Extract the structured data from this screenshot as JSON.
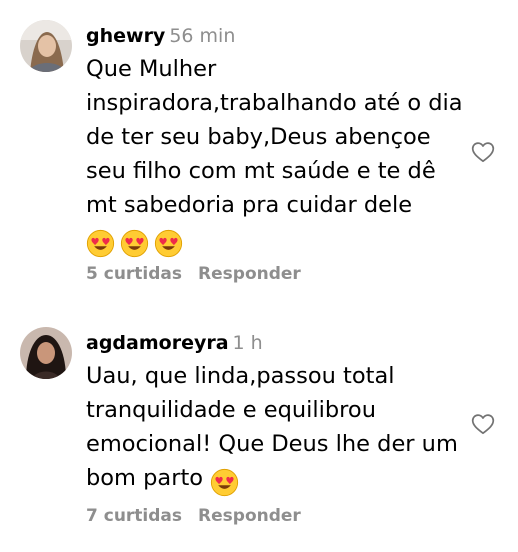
{
  "comments": [
    {
      "username": "ghewry",
      "time": "56 min",
      "text": "Que Mulher inspiradora,trabalhando até o dia de ter seu baby,Deus abençoe seu filho com mt saúde e te dê mt sabedoria pra cuidar dele",
      "emoji_icon": "heart-eyes-emoji-icon",
      "likes": "5 curtidas",
      "reply_label": "Responder"
    },
    {
      "username": "agdamoreyra",
      "time": "1 h",
      "text": "Uau, que linda,passou total tranquilidade e equilibrou emocional! Que Deus lhe der um bom parto",
      "emoji_icon": "heart-eyes-emoji-icon",
      "likes": "7 curtidas",
      "reply_label": "Responder"
    }
  ],
  "colors": {
    "text": "#000000",
    "secondary": "#8e8e8e",
    "background": "#ffffff"
  }
}
